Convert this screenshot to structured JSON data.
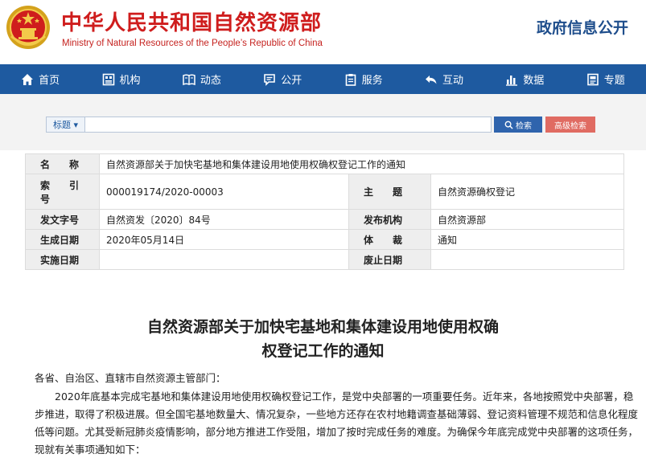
{
  "header": {
    "title_cn": "中华人民共和国自然资源部",
    "title_en": "Ministry of Natural Resources of the People’s Republic of China",
    "gov_open": "政府信息公开",
    "colors": {
      "brand_red": "#cf1d1d",
      "nav_blue": "#1e5aa0"
    }
  },
  "nav": {
    "items": [
      {
        "label": "首页",
        "icon": "home-icon"
      },
      {
        "label": "机构",
        "icon": "org-icon"
      },
      {
        "label": "动态",
        "icon": "book-icon"
      },
      {
        "label": "公开",
        "icon": "chat-icon"
      },
      {
        "label": "服务",
        "icon": "clipboard-icon"
      },
      {
        "label": "互动",
        "icon": "reply-icon"
      },
      {
        "label": "数据",
        "icon": "bar-chart-icon"
      },
      {
        "label": "专题",
        "icon": "topic-icon"
      }
    ]
  },
  "search": {
    "type_label": "标题 ▾",
    "placeholder": "",
    "search_label": "检索",
    "advanced_label": "高级检索"
  },
  "info_table": {
    "name_label": "名　　称",
    "name_value": "自然资源部关于加快宅基地和集体建设用地使用权确权登记工作的通知",
    "index_label": "索　　引　　号",
    "index_value": "000019174/2020-00003",
    "topic_label": "主　　题",
    "topic_value": "自然资源确权登记",
    "doc_no_label": "发文字号",
    "doc_no_value": "自然资发〔2020〕84号",
    "issuer_label": "发布机构",
    "issuer_value": "自然资源部",
    "date_label": "生成日期",
    "date_value": "2020年05月14日",
    "genre_label": "体　　裁",
    "genre_value": "通知",
    "effective_label": "实施日期",
    "effective_value": "",
    "expire_label": "废止日期",
    "expire_value": ""
  },
  "article": {
    "title_line1": "自然资源部关于加快宅基地和集体建设用地使用权确",
    "title_line2": "权登记工作的通知",
    "addressee": "各省、自治区、直辖市自然资源主管部门：",
    "lines": [
      "2020年底基本完成宅基地和集体建设用地使用权确权登记工作，是党中央部署的一项重要任务。近年来，各地按照党中央部署，稳",
      "步推进，取得了积极进展。但全国宅基地数量大、情况复杂，一些地方还存在农村地籍调查基础薄弱、登记资料管理不规范和信息化程度",
      "低等问题。尤其受新冠肺炎疫情影响，部分地方推进工作受阻，增加了按时完成任务的难度。为确保今年底完成党中央部署的这项任务，",
      "现就有关事项通知如下："
    ]
  }
}
